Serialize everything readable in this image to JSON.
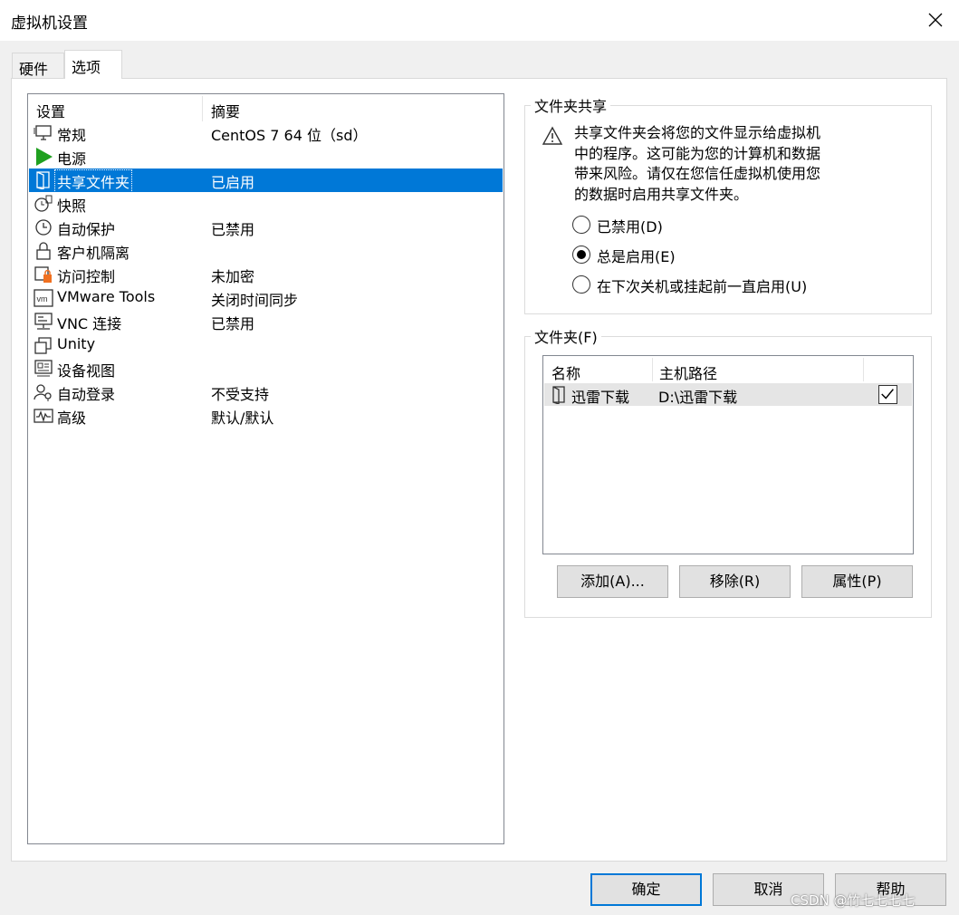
{
  "window": {
    "title": "虚拟机设置"
  },
  "tabs": [
    {
      "label": "硬件"
    },
    {
      "label": "选项"
    }
  ],
  "settings": {
    "columns": {
      "setting": "设置",
      "summary": "摘要"
    },
    "rows": [
      {
        "icon": "monitor-icon",
        "name": "常规",
        "summary": "CentOS 7 64 位（sd）"
      },
      {
        "icon": "power-icon",
        "name": "电源",
        "summary": ""
      },
      {
        "icon": "shared-folder-icon",
        "name": "共享文件夹",
        "summary": "已启用"
      },
      {
        "icon": "snapshot-icon",
        "name": "快照",
        "summary": ""
      },
      {
        "icon": "clock-icon",
        "name": "自动保护",
        "summary": "已禁用"
      },
      {
        "icon": "lock-icon",
        "name": "客户机隔离",
        "summary": ""
      },
      {
        "icon": "access-control-icon",
        "name": "访问控制",
        "summary": "未加密"
      },
      {
        "icon": "vmware-tools-icon",
        "name": "VMware Tools",
        "summary": "关闭时间同步"
      },
      {
        "icon": "vnc-icon",
        "name": "VNC 连接",
        "summary": "已禁用"
      },
      {
        "icon": "unity-icon",
        "name": "Unity",
        "summary": ""
      },
      {
        "icon": "device-view-icon",
        "name": "设备视图",
        "summary": ""
      },
      {
        "icon": "autologin-icon",
        "name": "自动登录",
        "summary": "不受支持"
      },
      {
        "icon": "advanced-icon",
        "name": "高级",
        "summary": "默认/默认"
      }
    ],
    "selected_row": "共享文件夹"
  },
  "sharing": {
    "title": "文件夹共享",
    "warning_lines": [
      "共享文件夹会将您的文件显示给虚拟机",
      "中的程序。这可能为您的计算机和数据",
      "带来风险。请仅在您信任虚拟机使用您",
      "的数据时启用共享文件夹。"
    ],
    "options": {
      "disabled": "已禁用(D)",
      "always": "总是启用(E)",
      "until": "在下次关机或挂起前一直启用(U)"
    },
    "selected": "always"
  },
  "folders": {
    "title": "文件夹(F)",
    "columns": {
      "name": "名称",
      "path": "主机路径"
    },
    "rows": [
      {
        "name": "迅雷下载",
        "path": "D:\\迅雷下载",
        "checked": true
      }
    ],
    "buttons": {
      "add": "添加(A)...",
      "remove": "移除(R)",
      "props": "属性(P)"
    }
  },
  "footer": {
    "ok": "确定",
    "cancel": "取消",
    "help": "帮助"
  },
  "watermark": "CSDN @竹七七七七",
  "colors": {
    "selection": "#0078d7",
    "power_green": "#20a020",
    "lock_orange": "#f07020"
  }
}
